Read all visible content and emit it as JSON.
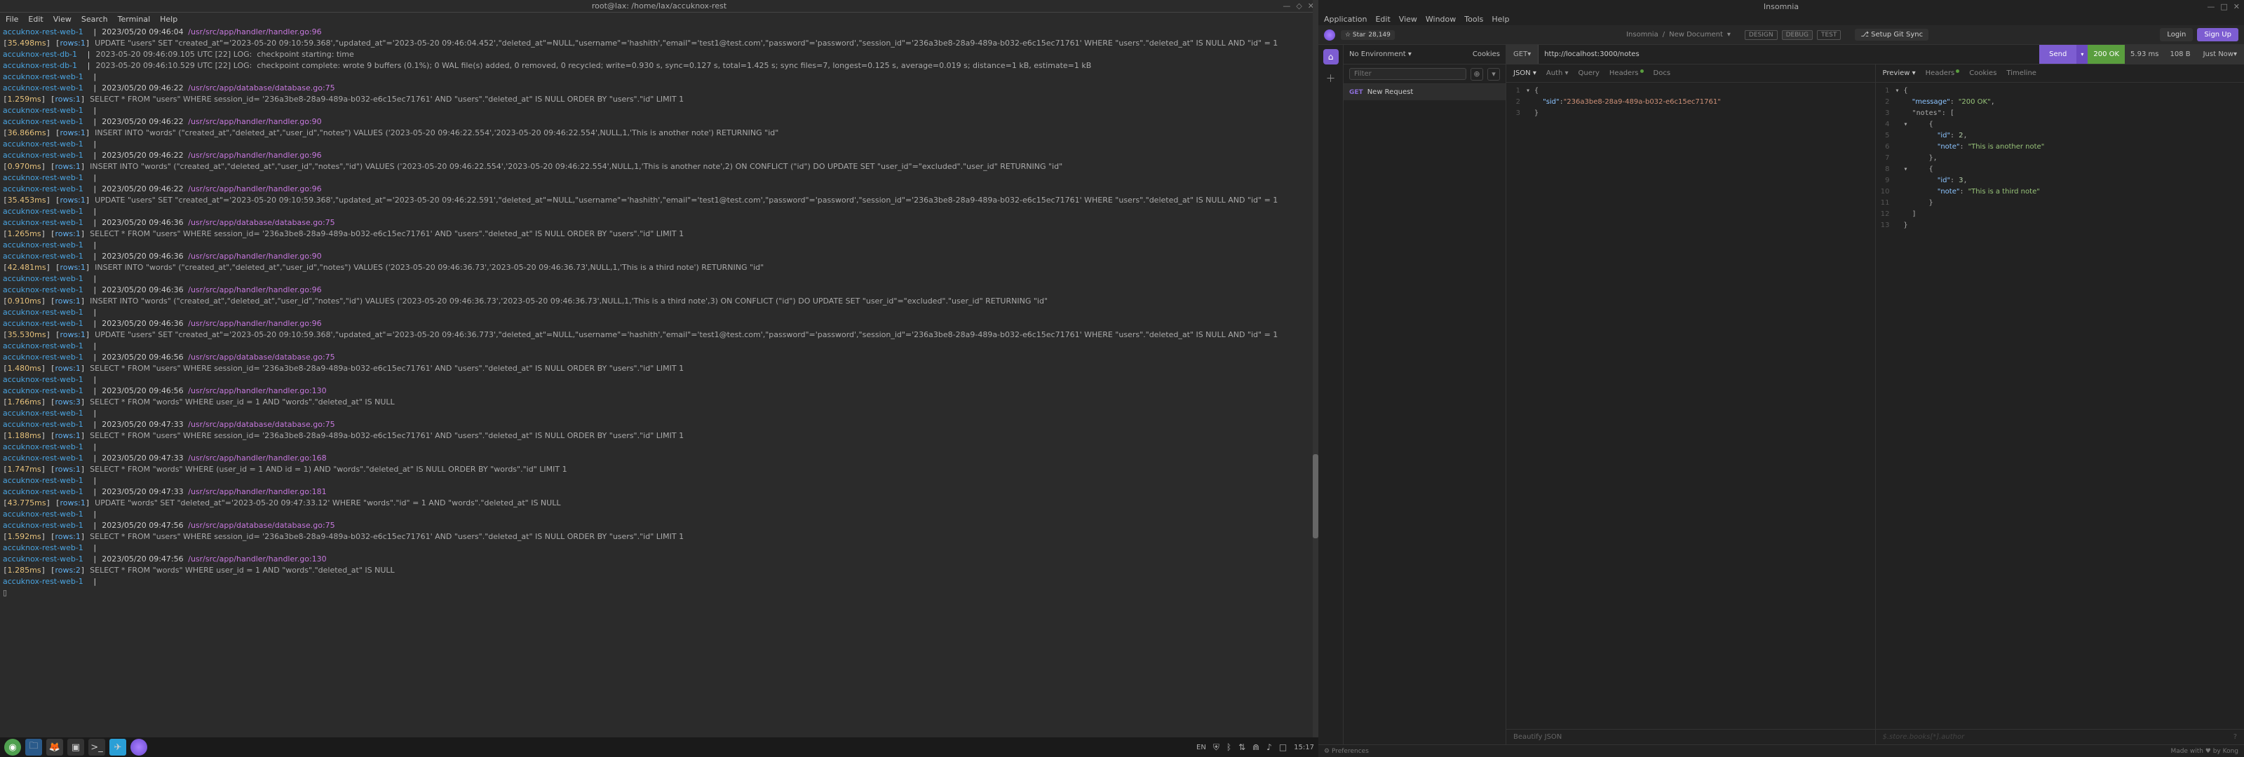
{
  "terminal": {
    "title": "root@lax: /home/lax/accuknox-rest",
    "menu": [
      "File",
      "Edit",
      "View",
      "Search",
      "Terminal",
      "Help"
    ],
    "lines": [
      {
        "svc": "accuknox-rest-web-1",
        "ts": "2023/05/20 09:46:04",
        "path": "/usr/src/app/handler/handler.go:96"
      },
      {
        "svc": "",
        "txt": "[35.498ms] [rows:1] UPDATE \"users\" SET \"created_at\"='2023-05-20 09:10:59.368',\"updated_at\"='2023-05-20 09:46:04.452',\"deleted_at\"=NULL,\"username\"='hashith',\"email\"='test1@test.com',\"password\"='password',\"session_id\"='236a3be8-28a9-489a-b032-e6c15ec71761' WHERE \"users\".\"deleted_at\" IS NULL AND \"id\" = 1",
        "t": "35.498ms",
        "r": "rows:1"
      },
      {
        "svc": "accuknox-rest-db-1",
        "txt": "2023-05-20 09:46:09.105 UTC [22] LOG:  checkpoint starting: time"
      },
      {
        "svc": "accuknox-rest-db-1",
        "txt": "2023-05-20 09:46:10.529 UTC [22] LOG:  checkpoint complete: wrote 9 buffers (0.1%); 0 WAL file(s) added, 0 removed, 0 recycled; write=0.930 s, sync=0.127 s, total=1.425 s; sync files=7, longest=0.125 s, average=0.019 s; distance=1 kB, estimate=1 kB"
      },
      {
        "svc": "accuknox-rest-web-1"
      },
      {
        "svc": "accuknox-rest-web-1",
        "ts": "2023/05/20 09:46:22",
        "path": "/usr/src/app/database/database.go:75"
      },
      {
        "svc": "",
        "txt": "[1.259ms] [rows:1] SELECT * FROM \"users\" WHERE session_id= '236a3be8-28a9-489a-b032-e6c15ec71761' AND \"users\".\"deleted_at\" IS NULL ORDER BY \"users\".\"id\" LIMIT 1",
        "t": "1.259ms",
        "r": "rows:1"
      },
      {
        "svc": "accuknox-rest-web-1"
      },
      {
        "svc": "accuknox-rest-web-1",
        "ts": "2023/05/20 09:46:22",
        "path": "/usr/src/app/handler/handler.go:90"
      },
      {
        "svc": "",
        "txt": "[36.866ms] [rows:1] INSERT INTO \"words\" (\"created_at\",\"deleted_at\",\"user_id\",\"notes\") VALUES ('2023-05-20 09:46:22.554','2023-05-20 09:46:22.554',NULL,1,'This is another note') RETURNING \"id\"",
        "t": "36.866ms",
        "r": "rows:1"
      },
      {
        "svc": "accuknox-rest-web-1"
      },
      {
        "svc": "accuknox-rest-web-1",
        "ts": "2023/05/20 09:46:22",
        "path": "/usr/src/app/handler/handler.go:96"
      },
      {
        "svc": "",
        "txt": "[0.970ms] [rows:1] INSERT INTO \"words\" (\"created_at\",\"deleted_at\",\"user_id\",\"notes\",\"id\") VALUES ('2023-05-20 09:46:22.554','2023-05-20 09:46:22.554',NULL,1,'This is another note',2) ON CONFLICT (\"id\") DO UPDATE SET \"user_id\"=\"excluded\".\"user_id\" RETURNING \"id\"",
        "t": "0.970ms",
        "r": "rows:1"
      },
      {
        "svc": "accuknox-rest-web-1"
      },
      {
        "svc": "accuknox-rest-web-1",
        "ts": "2023/05/20 09:46:22",
        "path": "/usr/src/app/handler/handler.go:96"
      },
      {
        "svc": "",
        "txt": "[35.453ms] [rows:1] UPDATE \"users\" SET \"created_at\"='2023-05-20 09:10:59.368',\"updated_at\"='2023-05-20 09:46:22.591',\"deleted_at\"=NULL,\"username\"='hashith',\"email\"='test1@test.com',\"password\"='password',\"session_id\"='236a3be8-28a9-489a-b032-e6c15ec71761' WHERE \"users\".\"deleted_at\" IS NULL AND \"id\" = 1",
        "t": "35.453ms",
        "r": "rows:1"
      },
      {
        "svc": "accuknox-rest-web-1"
      },
      {
        "svc": "accuknox-rest-web-1",
        "ts": "2023/05/20 09:46:36",
        "path": "/usr/src/app/database/database.go:75"
      },
      {
        "svc": "",
        "txt": "[1.265ms] [rows:1] SELECT * FROM \"users\" WHERE session_id= '236a3be8-28a9-489a-b032-e6c15ec71761' AND \"users\".\"deleted_at\" IS NULL ORDER BY \"users\".\"id\" LIMIT 1",
        "t": "1.265ms",
        "r": "rows:1"
      },
      {
        "svc": "accuknox-rest-web-1"
      },
      {
        "svc": "accuknox-rest-web-1",
        "ts": "2023/05/20 09:46:36",
        "path": "/usr/src/app/handler/handler.go:90"
      },
      {
        "svc": "",
        "txt": "[42.481ms] [rows:1] INSERT INTO \"words\" (\"created_at\",\"deleted_at\",\"user_id\",\"notes\") VALUES ('2023-05-20 09:46:36.73','2023-05-20 09:46:36.73',NULL,1,'This is a third note') RETURNING \"id\"",
        "t": "42.481ms",
        "r": "rows:1"
      },
      {
        "svc": "accuknox-rest-web-1"
      },
      {
        "svc": "accuknox-rest-web-1",
        "ts": "2023/05/20 09:46:36",
        "path": "/usr/src/app/handler/handler.go:96"
      },
      {
        "svc": "",
        "txt": "[0.910ms] [rows:1] INSERT INTO \"words\" (\"created_at\",\"deleted_at\",\"user_id\",\"notes\",\"id\") VALUES ('2023-05-20 09:46:36.73','2023-05-20 09:46:36.73',NULL,1,'This is a third note',3) ON CONFLICT (\"id\") DO UPDATE SET \"user_id\"=\"excluded\".\"user_id\" RETURNING \"id\"",
        "t": "0.910ms",
        "r": "rows:1"
      },
      {
        "svc": "accuknox-rest-web-1"
      },
      {
        "svc": "accuknox-rest-web-1",
        "ts": "2023/05/20 09:46:36",
        "path": "/usr/src/app/handler/handler.go:96"
      },
      {
        "svc": "",
        "txt": "[35.530ms] [rows:1] UPDATE \"users\" SET \"created_at\"='2023-05-20 09:10:59.368',\"updated_at\"='2023-05-20 09:46:36.773',\"deleted_at\"=NULL,\"username\"='hashith',\"email\"='test1@test.com',\"password\"='password',\"session_id\"='236a3be8-28a9-489a-b032-e6c15ec71761' WHERE \"users\".\"deleted_at\" IS NULL AND \"id\" = 1",
        "t": "35.530ms",
        "r": "rows:1"
      },
      {
        "svc": "accuknox-rest-web-1"
      },
      {
        "svc": "accuknox-rest-web-1",
        "ts": "2023/05/20 09:46:56",
        "path": "/usr/src/app/database/database.go:75"
      },
      {
        "svc": "",
        "txt": "[1.480ms] [rows:1] SELECT * FROM \"users\" WHERE session_id= '236a3be8-28a9-489a-b032-e6c15ec71761' AND \"users\".\"deleted_at\" IS NULL ORDER BY \"users\".\"id\" LIMIT 1",
        "t": "1.480ms",
        "r": "rows:1"
      },
      {
        "svc": "accuknox-rest-web-1"
      },
      {
        "svc": "accuknox-rest-web-1",
        "ts": "2023/05/20 09:46:56",
        "path": "/usr/src/app/handler/handler.go:130"
      },
      {
        "svc": "",
        "txt": "[1.766ms] [rows:3] SELECT * FROM \"words\" WHERE user_id = 1 AND \"words\".\"deleted_at\" IS NULL",
        "t": "1.766ms",
        "r": "rows:3"
      },
      {
        "svc": "accuknox-rest-web-1"
      },
      {
        "svc": "accuknox-rest-web-1",
        "ts": "2023/05/20 09:47:33",
        "path": "/usr/src/app/database/database.go:75"
      },
      {
        "svc": "",
        "txt": "[1.188ms] [rows:1] SELECT * FROM \"users\" WHERE session_id= '236a3be8-28a9-489a-b032-e6c15ec71761' AND \"users\".\"deleted_at\" IS NULL ORDER BY \"users\".\"id\" LIMIT 1",
        "t": "1.188ms",
        "r": "rows:1"
      },
      {
        "svc": "accuknox-rest-web-1"
      },
      {
        "svc": "accuknox-rest-web-1",
        "ts": "2023/05/20 09:47:33",
        "path": "/usr/src/app/handler/handler.go:168"
      },
      {
        "svc": "",
        "txt": "[1.747ms] [rows:1] SELECT * FROM \"words\" WHERE (user_id = 1 AND id = 1) AND \"words\".\"deleted_at\" IS NULL ORDER BY \"words\".\"id\" LIMIT 1",
        "t": "1.747ms",
        "r": "rows:1"
      },
      {
        "svc": "accuknox-rest-web-1"
      },
      {
        "svc": "accuknox-rest-web-1",
        "ts": "2023/05/20 09:47:33",
        "path": "/usr/src/app/handler/handler.go:181"
      },
      {
        "svc": "",
        "txt": "[43.775ms] [rows:1] UPDATE \"words\" SET \"deleted_at\"='2023-05-20 09:47:33.12' WHERE \"words\".\"id\" = 1 AND \"words\".\"deleted_at\" IS NULL",
        "t": "43.775ms",
        "r": "rows:1"
      },
      {
        "svc": "accuknox-rest-web-1"
      },
      {
        "svc": "accuknox-rest-web-1",
        "ts": "2023/05/20 09:47:56",
        "path": "/usr/src/app/database/database.go:75"
      },
      {
        "svc": "",
        "txt": "[1.592ms] [rows:1] SELECT * FROM \"users\" WHERE session_id= '236a3be8-28a9-489a-b032-e6c15ec71761' AND \"users\".\"deleted_at\" IS NULL ORDER BY \"users\".\"id\" LIMIT 1",
        "t": "1.592ms",
        "r": "rows:1"
      },
      {
        "svc": "accuknox-rest-web-1"
      },
      {
        "svc": "accuknox-rest-web-1",
        "ts": "2023/05/20 09:47:56",
        "path": "/usr/src/app/handler/handler.go:130"
      },
      {
        "svc": "",
        "txt": "[1.285ms] [rows:2] SELECT * FROM \"words\" WHERE user_id = 1 AND \"words\".\"deleted_at\" IS NULL",
        "t": "1.285ms",
        "r": "rows:2"
      },
      {
        "svc": "accuknox-rest-web-1"
      },
      {
        "svc": "",
        "txt": "▯"
      }
    ]
  },
  "insomnia": {
    "title": "Insomnia",
    "menu": [
      "Application",
      "Edit",
      "View",
      "Window",
      "Tools",
      "Help"
    ],
    "star": {
      "label": "☆ Star",
      "count": "28,149"
    },
    "breadcrumb": {
      "ws": "Insomnia",
      "doc": "New Document"
    },
    "tags": [
      "DESIGN",
      "DEBUG",
      "TEST"
    ],
    "git": "⎇ Setup Git Sync",
    "login": "Login",
    "signup": "Sign Up",
    "env": "No Environment",
    "cookies": "Cookies",
    "filter_ph": "Filter",
    "request": {
      "method": "GET",
      "name": "New Request"
    },
    "url": {
      "method": "GET",
      "value": "http://localhost:3000/notes"
    },
    "send": "Send",
    "status": {
      "code": "200 OK",
      "time": "5.93 ms",
      "size": "108 B",
      "when": "Just Now"
    },
    "req_tabs": [
      "JSON",
      "Auth",
      "Query",
      "Headers",
      "Docs"
    ],
    "res_tabs": [
      "Preview",
      "Headers",
      "Cookies",
      "Timeline"
    ],
    "req_body_lines": [
      {
        "n": 1,
        "txt": "▾ {",
        "cls": ""
      },
      {
        "n": 2,
        "txt": "    \"sid\":\"236a3be8-28a9-489a-b032-e6c15ec71761\"",
        "key": "sid",
        "val": "236a3be8-28a9-489a-b032-e6c15ec71761"
      },
      {
        "n": 3,
        "txt": "  }"
      }
    ],
    "res_body_lines": [
      {
        "n": 1,
        "txt": "▾ {"
      },
      {
        "n": 2,
        "txt": "    \"message\": \"200 OK\",",
        "key": "message",
        "val": "200 OK"
      },
      {
        "n": 3,
        "txt": "    \"notes\": ["
      },
      {
        "n": 4,
        "txt": "  ▾     {"
      },
      {
        "n": 5,
        "txt": "          \"id\": 2,",
        "key": "id",
        "num": "2"
      },
      {
        "n": 6,
        "txt": "          \"note\": \"This is another note\"",
        "key": "note",
        "val": "This is another note"
      },
      {
        "n": 7,
        "txt": "        },"
      },
      {
        "n": 8,
        "txt": "  ▾     {"
      },
      {
        "n": 9,
        "txt": "          \"id\": 3,",
        "key": "id",
        "num": "3"
      },
      {
        "n": 10,
        "txt": "          \"note\": \"This is a third note\"",
        "key": "note",
        "val": "This is a third note"
      },
      {
        "n": 11,
        "txt": "        }"
      },
      {
        "n": 12,
        "txt": "    ]"
      },
      {
        "n": 13,
        "txt": "  }"
      }
    ],
    "beautify": "Beautify JSON",
    "res_filter_ph": "$.store.books[*].author",
    "prefs": "Preferences",
    "made": "Made with ♥ by Kong"
  },
  "taskbar": {
    "lang": "EN",
    "time": "15:17",
    "icons": [
      "mint",
      "files",
      "firefox",
      "terminal",
      "terminal2",
      "telegram",
      "insomnia"
    ]
  }
}
